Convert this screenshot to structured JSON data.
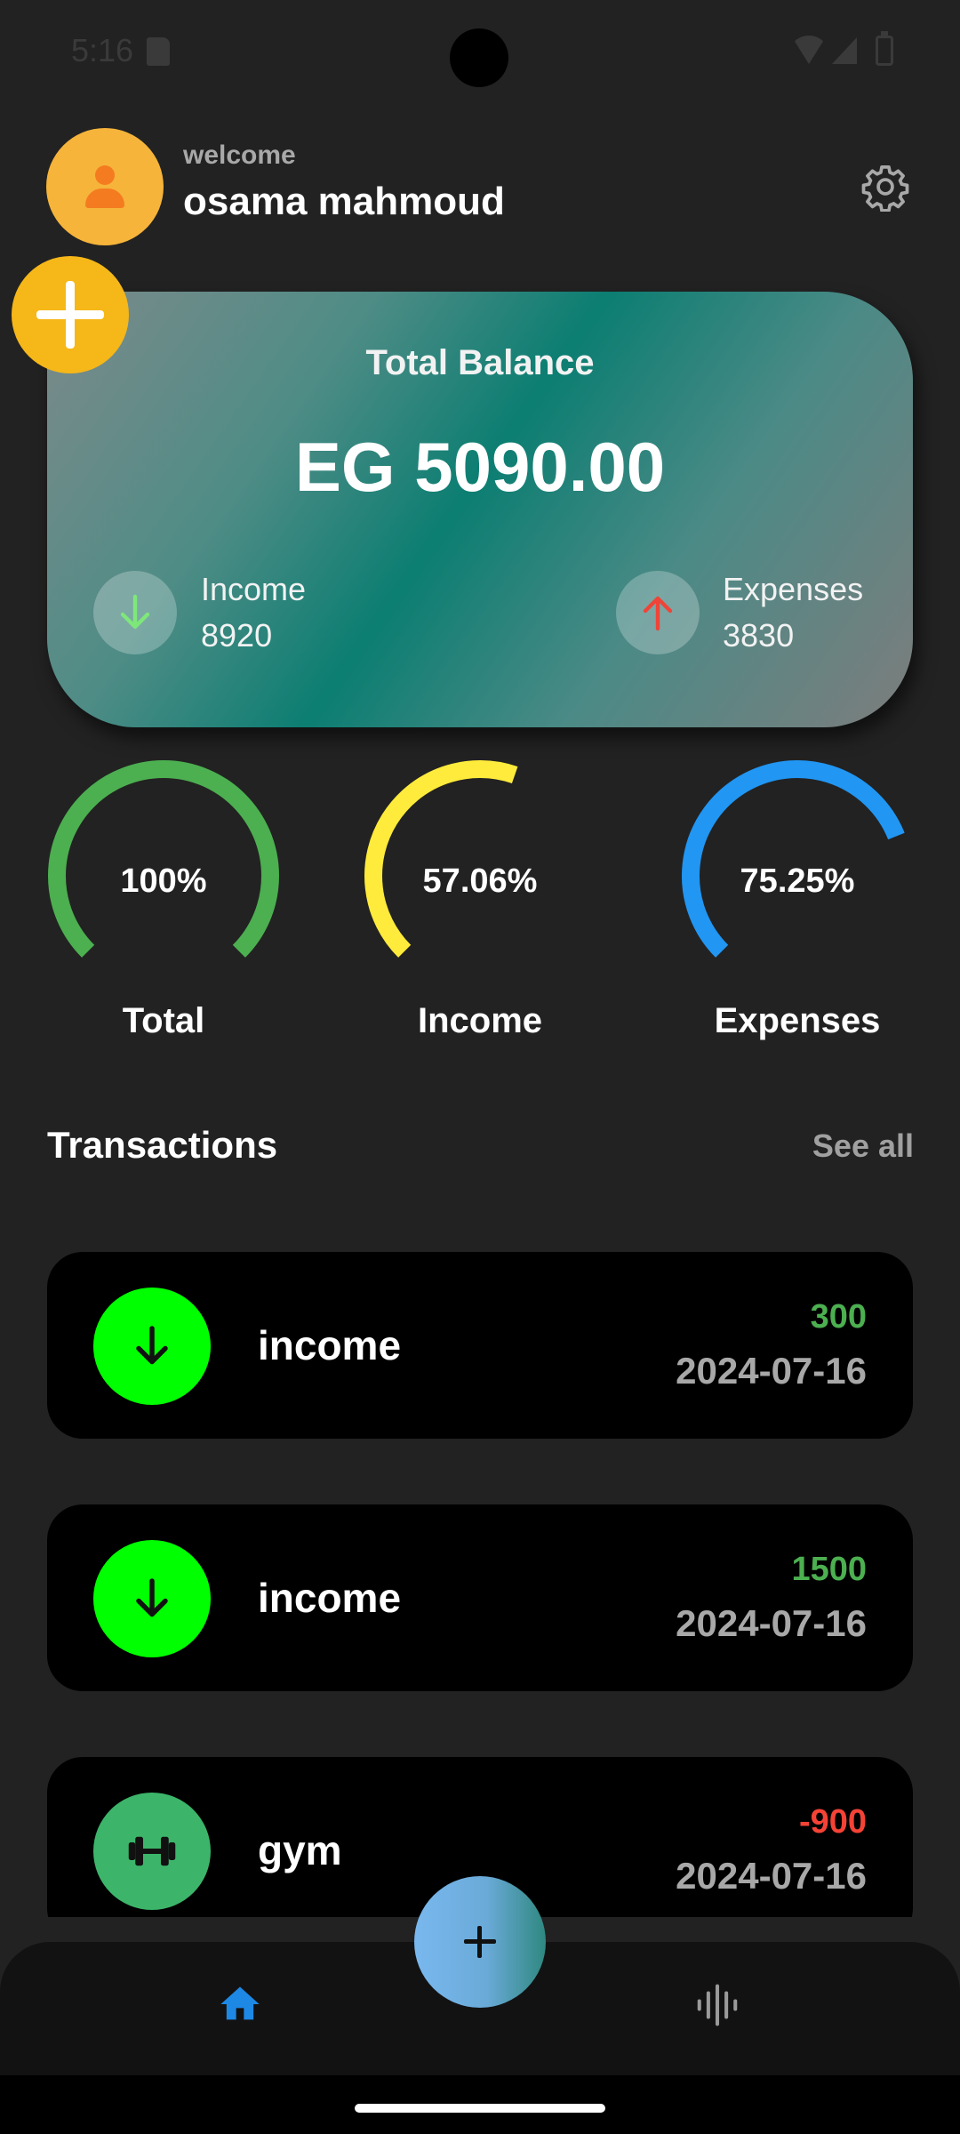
{
  "status_bar": {
    "time": "5:16"
  },
  "header": {
    "welcome": "welcome",
    "username": "osama mahmoud"
  },
  "balance_card": {
    "title": "Total Balance",
    "amount": "EG 5090.00",
    "income_label": "Income",
    "income_value": "8920",
    "expenses_label": "Expenses",
    "expenses_value": "3830"
  },
  "gauges": [
    {
      "label": "Total",
      "percent_text": "100%",
      "value": 100,
      "color": "#4caf50"
    },
    {
      "label": "Income",
      "percent_text": "57.06%",
      "value": 57.06,
      "color": "#ffeb3b"
    },
    {
      "label": "Expenses",
      "percent_text": "75.25%",
      "value": 75.25,
      "color": "#2196f3"
    }
  ],
  "transactions": {
    "title": "Transactions",
    "see_all": "See all",
    "items": [
      {
        "name": "income",
        "amount": "300",
        "date": "2024-07-16",
        "amount_color": "#4caf50",
        "icon": "arrow-down-icon",
        "icon_bg": "#00ff00"
      },
      {
        "name": "income",
        "amount": "1500",
        "date": "2024-07-16",
        "amount_color": "#4caf50",
        "icon": "arrow-down-icon",
        "icon_bg": "#00ff00"
      },
      {
        "name": "gym",
        "amount": "-900",
        "date": "2024-07-16",
        "amount_color": "#f44336",
        "icon": "dumbbell-icon",
        "icon_bg": "#3cb56a"
      }
    ]
  },
  "nav": {
    "home_icon": "home-icon",
    "stats_icon": "stats-icon",
    "accent": "#1e88e5"
  }
}
